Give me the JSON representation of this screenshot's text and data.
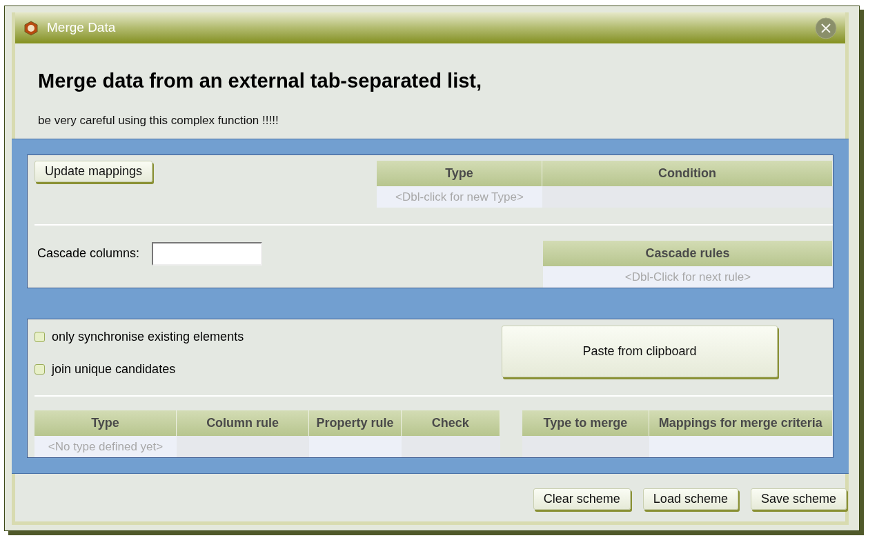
{
  "window": {
    "title": "Merge Data"
  },
  "heading": "Merge data from an external tab-separated list,",
  "warning": "be very careful using this complex function !!!!!",
  "update_button": "Update mappings",
  "type_table": {
    "columns": [
      "Type",
      "Condition"
    ],
    "rows": [
      [
        "<Dbl-click for new Type>",
        ""
      ]
    ]
  },
  "cascade": {
    "label": "Cascade columns:"
  },
  "cascade_table": {
    "columns": [
      "Cascade rules"
    ],
    "rows": [
      [
        "<Dbl-Click for next rule>"
      ]
    ]
  },
  "options": [
    {
      "label": "only synchronise existing elements",
      "checked": false
    },
    {
      "label": "join unique candidates",
      "checked": false
    }
  ],
  "paste_button": "Paste from clipboard",
  "merge_table": {
    "columns": [
      "Type",
      "Column rule",
      "Property rule",
      "Check",
      "",
      "Type to merge",
      "Mappings for merge criteria"
    ],
    "rows": [
      [
        "<No type defined yet>",
        "",
        "",
        "",
        "",
        "",
        ""
      ]
    ]
  },
  "buttons": [
    "Clear scheme",
    "Load scheme",
    "Save scheme"
  ]
}
